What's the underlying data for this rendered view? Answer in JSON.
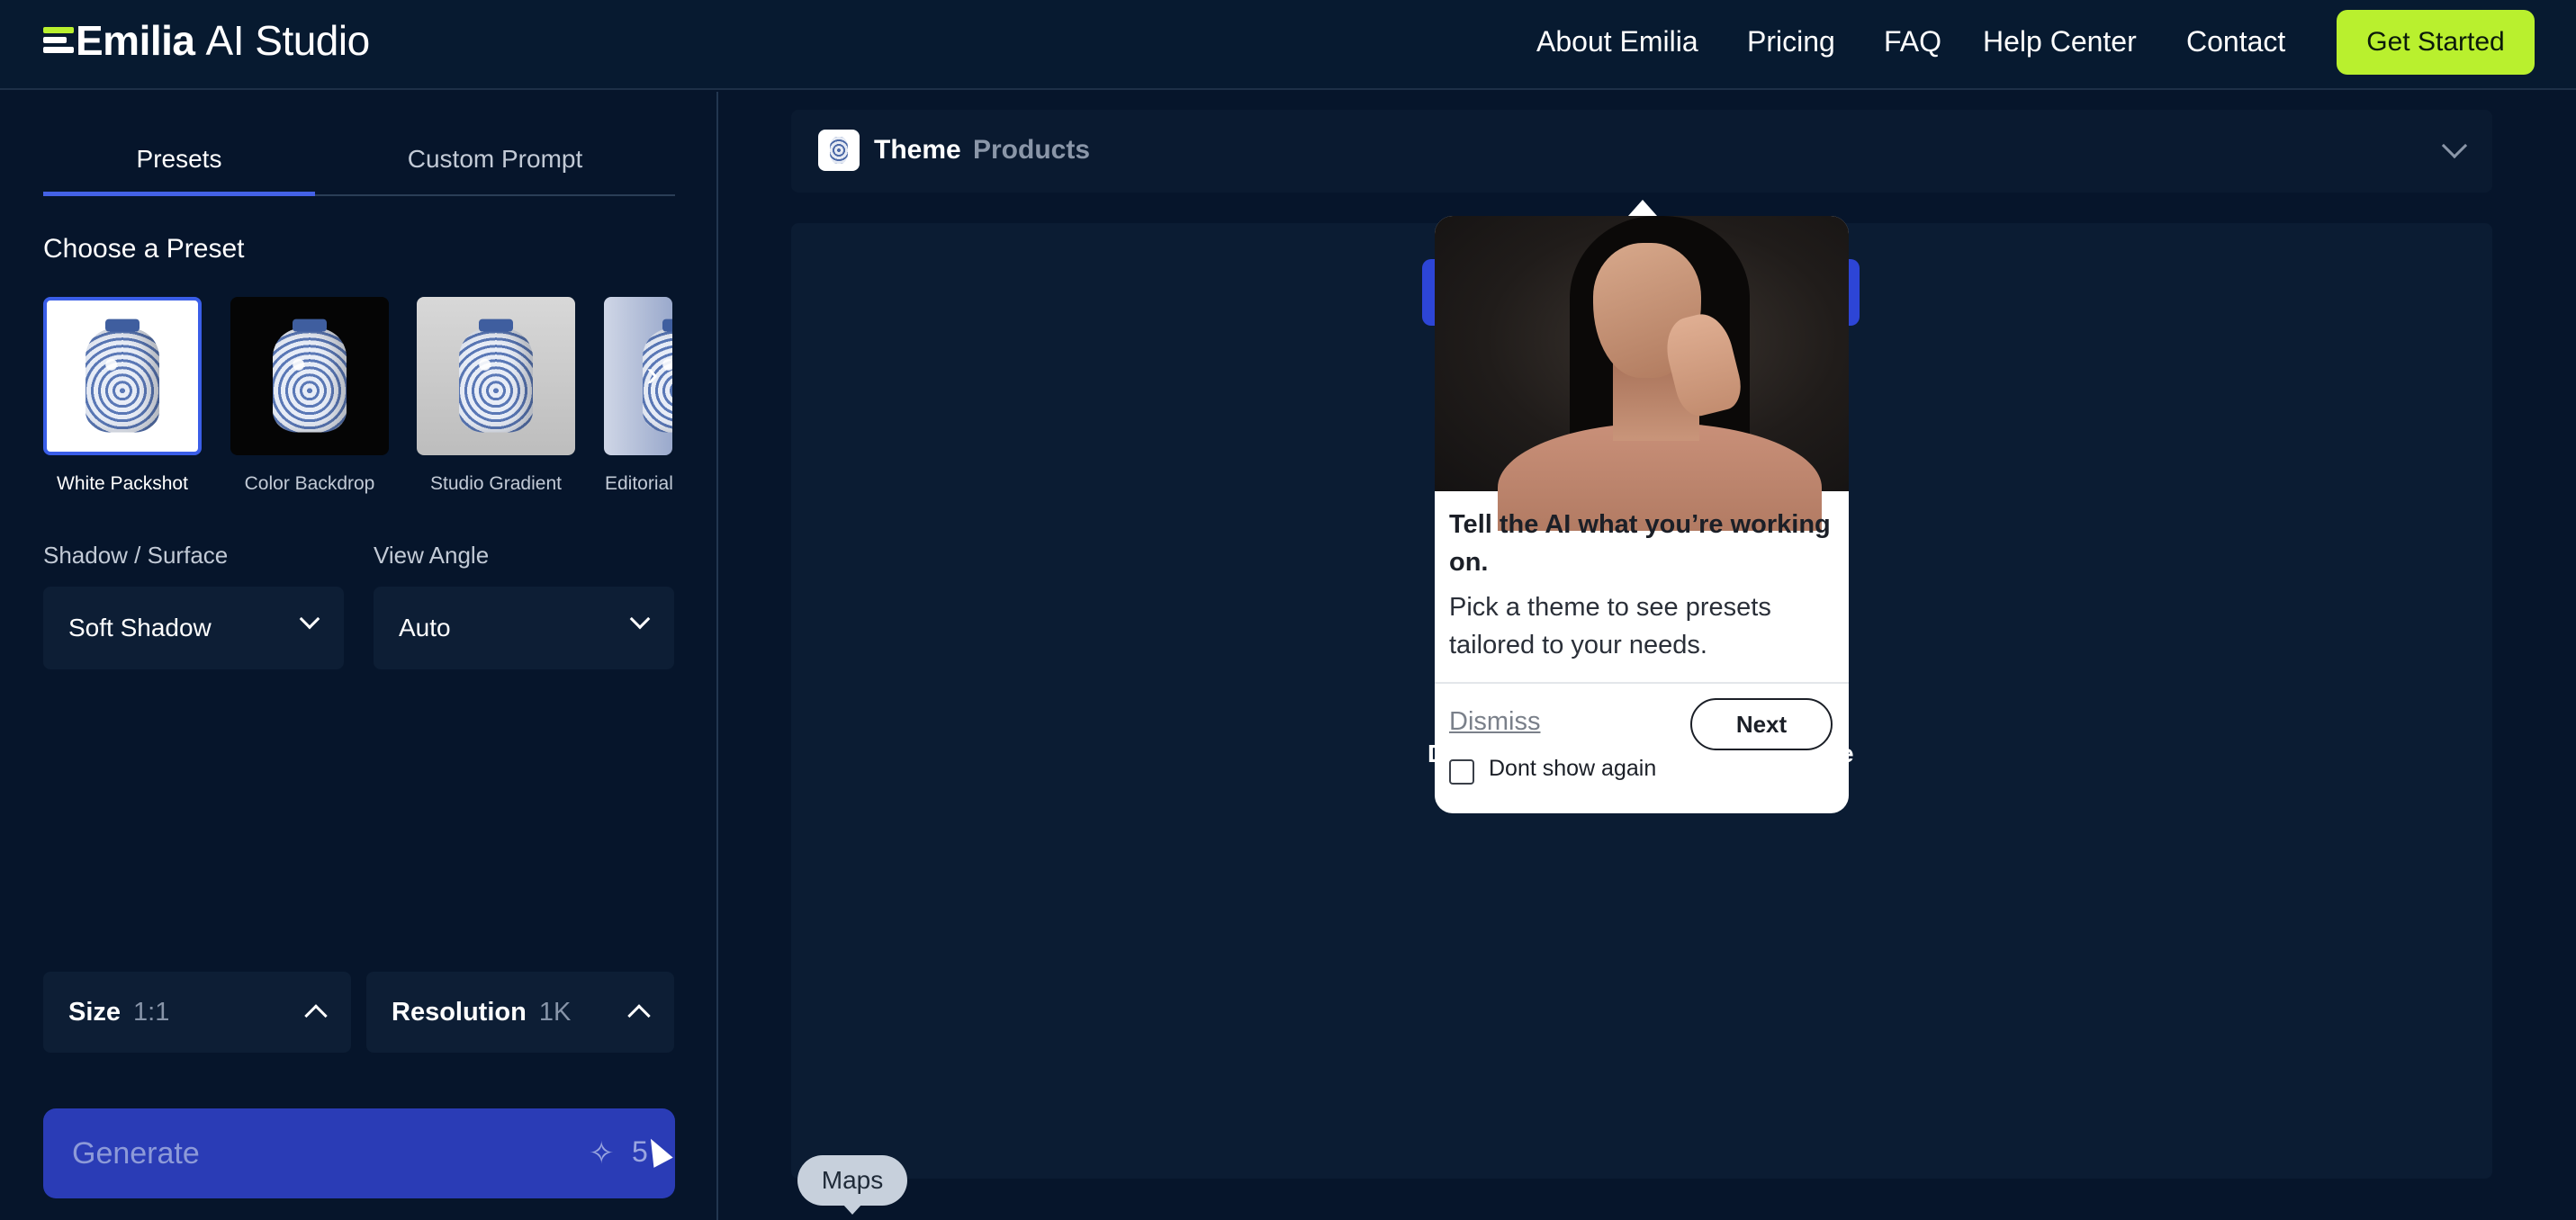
{
  "app": {
    "brand": "Emilia",
    "product": "AI Studio"
  },
  "nav": {
    "about": "About Emilia",
    "pricing": "Pricing",
    "faq": "FAQ",
    "help": "Help Center",
    "contact": "Contact",
    "cta": "Get Started"
  },
  "sidebar": {
    "tabs": [
      "Presets",
      "Custom Prompt"
    ],
    "section_title": "Choose a Preset",
    "presets": [
      {
        "label": "White Packshot",
        "selected": true
      },
      {
        "label": "Color Backdrop",
        "selected": false
      },
      {
        "label": "Studio Gradient",
        "selected": false
      },
      {
        "label": "Editorial",
        "selected": false
      }
    ],
    "shadow": {
      "label": "Shadow / Surface",
      "value": "Soft Shadow"
    },
    "angle": {
      "label": "View Angle",
      "value": "Auto"
    },
    "size": {
      "label": "Size",
      "value": "1:1"
    },
    "resolution": {
      "label": "Resolution",
      "value": "1K"
    },
    "generate": {
      "label": "Generate",
      "credits": "5"
    }
  },
  "theme": {
    "label": "Theme",
    "value": "Products"
  },
  "canvas": {
    "hidden_left": "D",
    "hidden_right": "e"
  },
  "maps_chip": "Maps",
  "popover": {
    "title": "Tell the AI what you’re working on.",
    "body": "Pick a theme to see presets tailored to your needs.",
    "dismiss": "Dismiss",
    "next": "Next",
    "dont_show": "Dont show again"
  },
  "colors": {
    "accent": "#b9f02e",
    "primary": "#2a3cb6",
    "background": "#06152b"
  }
}
